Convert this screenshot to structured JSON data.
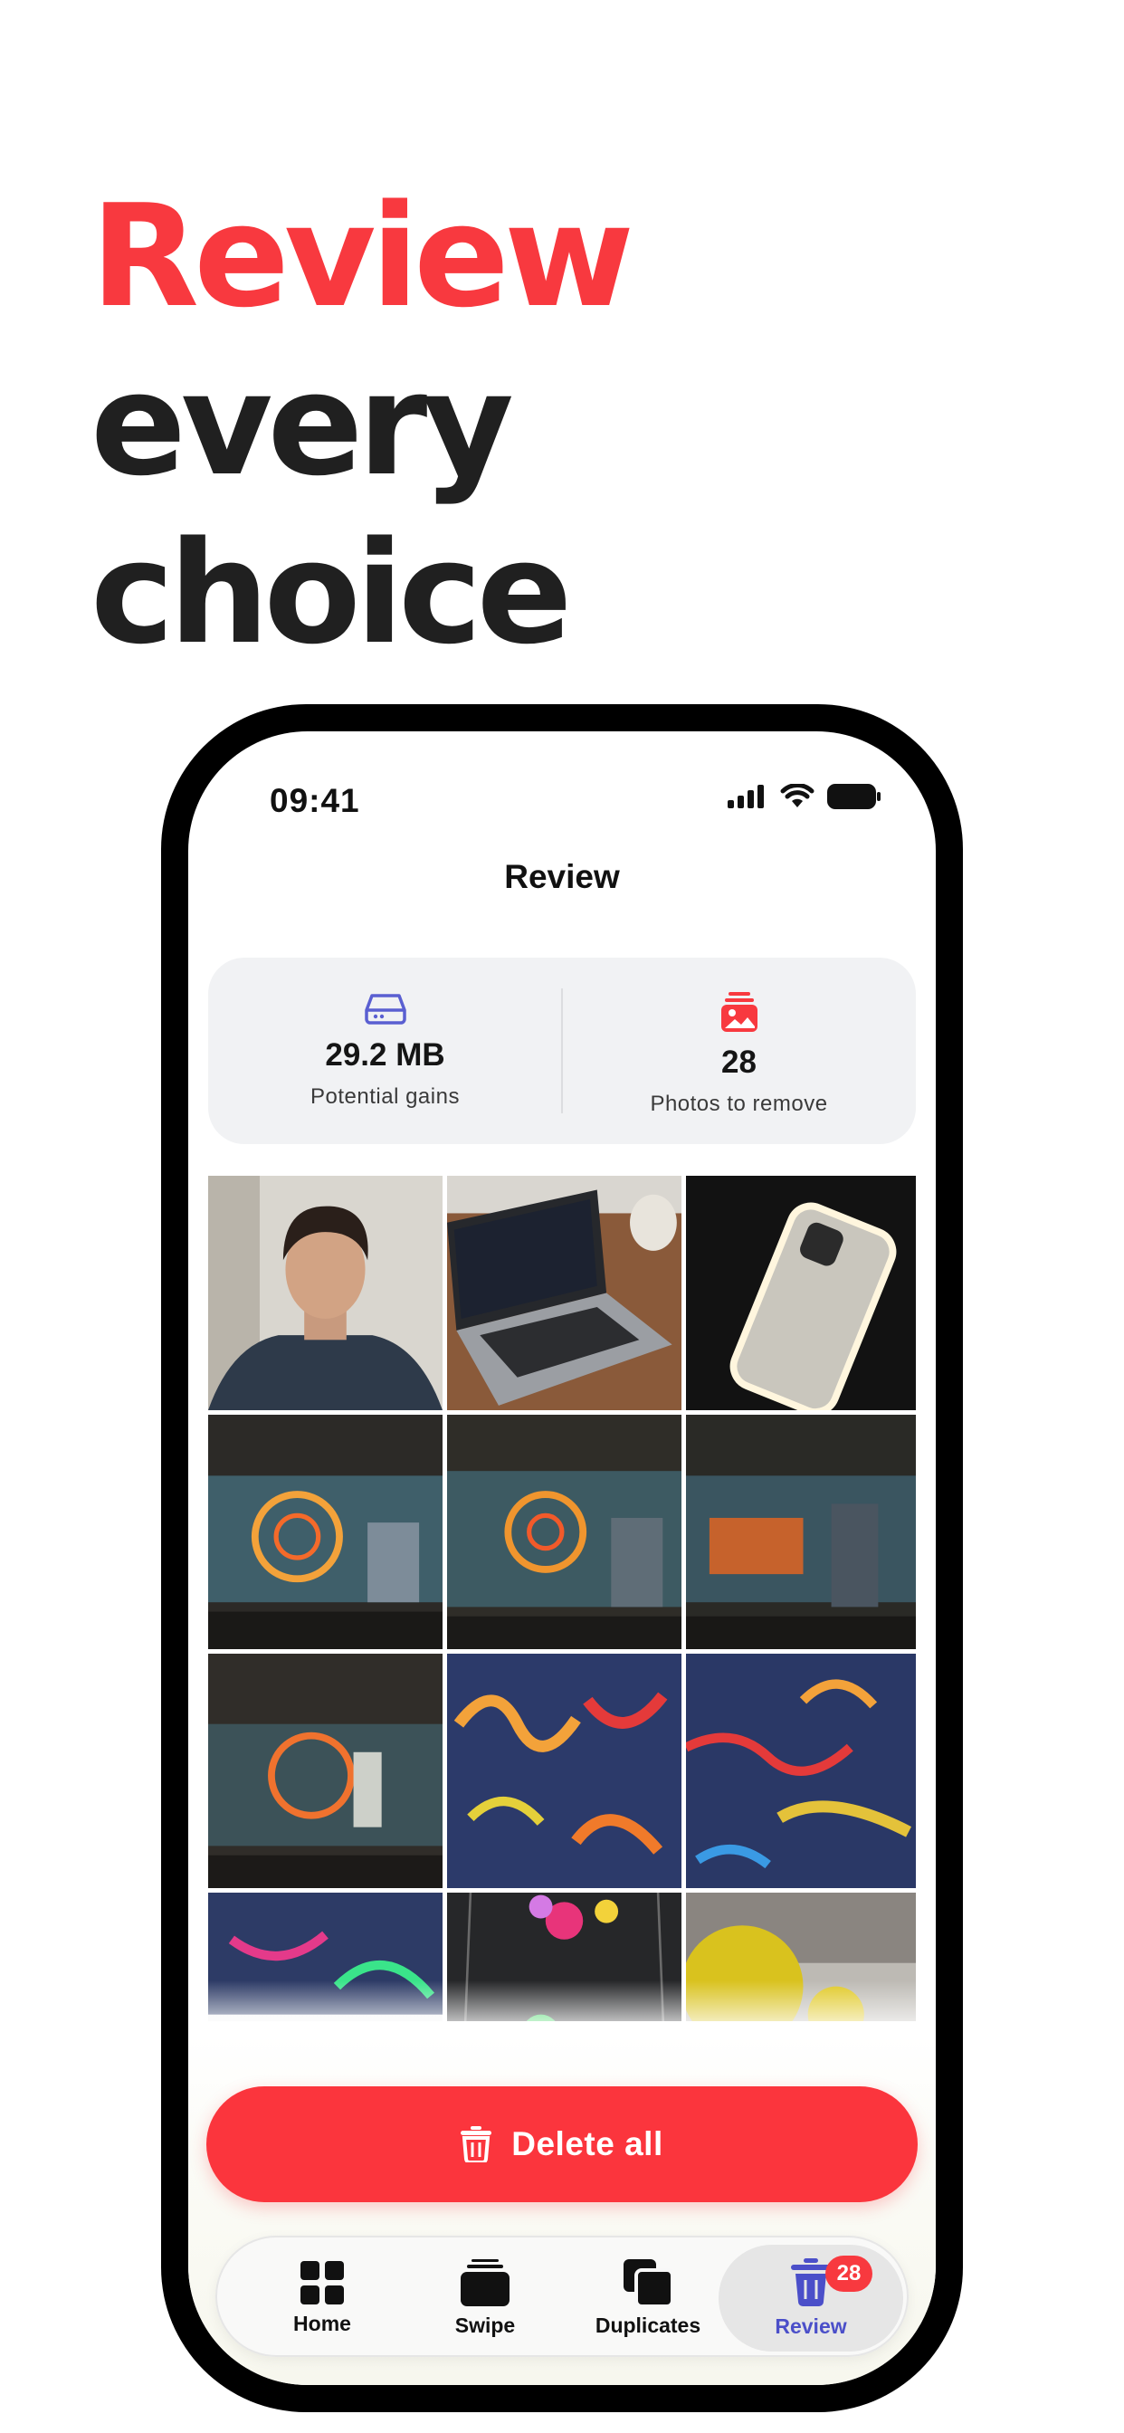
{
  "headline": {
    "accent": "Review",
    "rest_line1": " every",
    "line2": "choice"
  },
  "status_bar": {
    "time": "09:41"
  },
  "nav": {
    "title": "Review"
  },
  "stats": {
    "gains_value": "29.2 MB",
    "gains_label": "Potential gains",
    "remove_value": "28",
    "remove_label": "Photos to remove"
  },
  "delete_button": {
    "label": "Delete all"
  },
  "tabs": [
    {
      "label": "Home",
      "icon": "grid-icon"
    },
    {
      "label": "Swipe",
      "icon": "card-stack-icon"
    },
    {
      "label": "Duplicates",
      "icon": "duplicate-icon"
    },
    {
      "label": "Review",
      "icon": "trash-icon",
      "badge": "28",
      "active": true
    }
  ],
  "colors": {
    "accent_red": "#f8393f",
    "active_tab": "#4b4fc9",
    "stats_bg": "#f1f2f4"
  }
}
